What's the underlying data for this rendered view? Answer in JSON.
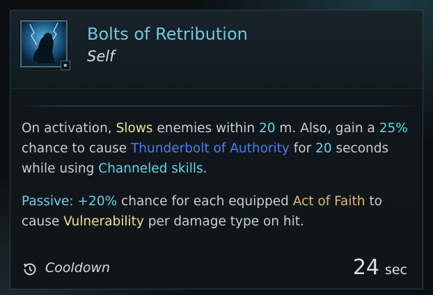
{
  "ability": {
    "name": "Bolts of Retribution",
    "target": "Self",
    "icon": "hooded-figure-lightning-icon"
  },
  "description": {
    "p1": [
      {
        "text": "On activation, ",
        "style": "plain"
      },
      {
        "text": "Slows",
        "style": "yellow"
      },
      {
        "text": " enemies within ",
        "style": "plain"
      },
      {
        "text": "20",
        "style": "cyan"
      },
      {
        "text": " m. Also, gain a ",
        "style": "plain"
      },
      {
        "text": "25%",
        "style": "cyan"
      },
      {
        "text": " chance to cause ",
        "style": "plain"
      },
      {
        "text": "Thunderbolt of Authority",
        "style": "blue"
      },
      {
        "text": " for ",
        "style": "plain"
      },
      {
        "text": "20",
        "style": "cyan"
      },
      {
        "text": " seconds while using ",
        "style": "plain"
      },
      {
        "text": "Channeled skills",
        "style": "cyan"
      },
      {
        "text": ".",
        "style": "plain"
      }
    ],
    "p2": [
      {
        "text": "Passive:",
        "style": "cyan"
      },
      {
        "text": " ",
        "style": "plain"
      },
      {
        "text": "+20%",
        "style": "cyan"
      },
      {
        "text": " chance for each equipped ",
        "style": "plain"
      },
      {
        "text": "Act of Faith",
        "style": "gold"
      },
      {
        "text": " to cause ",
        "style": "plain"
      },
      {
        "text": "Vulnerability",
        "style": "yellow"
      },
      {
        "text": " per damage type on hit.",
        "style": "plain"
      }
    ]
  },
  "cooldown": {
    "label": "Cooldown",
    "value": "24",
    "unit": "sec",
    "icon": "cooldown-clock-icon"
  },
  "colors": {
    "title": "#6fc9e0",
    "yellow": "#f0e08a",
    "cyan": "#63d4e4",
    "blue": "#4a7ff0",
    "gold": "#e0b96a"
  }
}
